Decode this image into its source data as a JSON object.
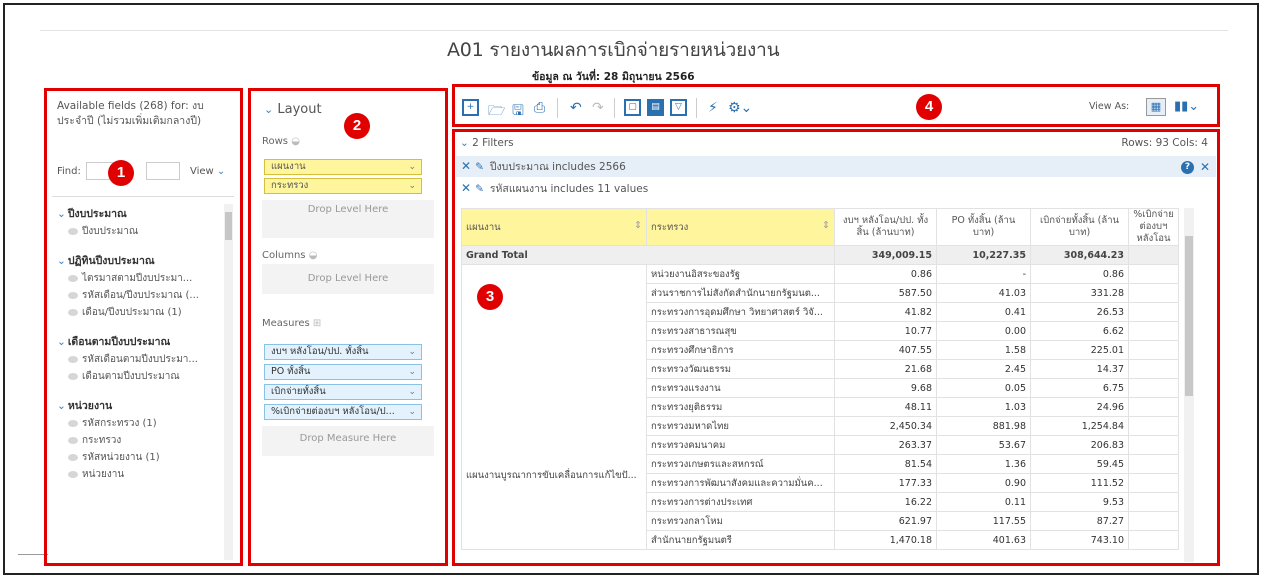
{
  "report": {
    "title": "A01 รายงานผลการเบิกจ่ายรายหน่วยงาน",
    "subtitle": "ข้อมูล ณ วันที่: 28 มิถุนายน 2566"
  },
  "badges": [
    "1",
    "2",
    "3",
    "4"
  ],
  "field_list": {
    "header": "Available fields (268) for: งบประจำปี (ไม่รวมเพิ่มเติมกลางปี)",
    "find_label": "Find:",
    "view_label": "View",
    "groups": [
      {
        "label": "ปีงบประมาณ",
        "items": [
          "ปีงบประมาณ"
        ]
      },
      {
        "label": "ปฏิทินปีงบประมาณ",
        "items": [
          "ไตรมาสตามปีงบประมา...",
          "รหัสเดือน/ปีงบประมาณ (...",
          "เดือน/ปีงบประมาณ (1)"
        ]
      },
      {
        "label": "เดือนตามปีงบประมาณ",
        "items": [
          "รหัสเดือนตามปีงบประมา...",
          "เดือนตามปีงบประมาณ"
        ]
      },
      {
        "label": "หน่วยงาน",
        "items": [
          "รหัสกระทรวง (1)",
          "กระทรวง",
          "รหัสหน่วยงาน (1)",
          "หน่วยงาน"
        ]
      }
    ]
  },
  "layout": {
    "title": "Layout",
    "rows_label": "Rows",
    "rows": [
      "แผนงาน",
      "กระทรวง"
    ],
    "drop_level": "Drop Level Here",
    "columns_label": "Columns",
    "columns_drop": "Drop Level Here",
    "measures_label": "Measures",
    "measures": [
      "งบฯ หลังโอน/ปป. ทั้งสิ้น",
      "PO ทั้งสิ้น",
      "เบิกจ่ายทั้งสิ้น",
      "%เบิกจ่ายต่องบฯ หลังโอน/ป..."
    ],
    "drop_measure": "Drop Measure Here"
  },
  "toolbar": {
    "view_as": "View As:",
    "icons": [
      "new-icon",
      "open-icon",
      "save-icon",
      "save-as-icon",
      "undo-icon",
      "redo-icon",
      "layout-icon",
      "table-icon",
      "filter-icon",
      "run-icon",
      "settings-icon",
      "grid-view-icon",
      "chart-view-icon"
    ]
  },
  "filters": {
    "summary": "2 Filters",
    "rows_cols": "Rows: 93  Cols: 4",
    "items": [
      "ปีงบประมาณ includes 2566",
      "รหัสแผนงาน includes 11 values"
    ]
  },
  "table": {
    "headers": [
      "แผนงาน",
      "กระทรวง",
      "งบฯ หลังโอน/ปป. ทั้งสิ้น (ล้านบาท)",
      "PO ทั้งสิ้น (ล้านบาท)",
      "เบิกจ่ายทั้งสิ้น (ล้านบาท)",
      "%เบิกจ่าย ต่องบฯ หลังโอน"
    ],
    "grand_total_label": "Grand Total",
    "grand_total": [
      "349,009.15",
      "10,227.35",
      "308,644.23"
    ],
    "plan_label": "แผนงานบูรณาการขับเคลื่อนการแก้ไขปั...",
    "rows": [
      {
        "ministry": "หน่วยงานอิสระของรัฐ",
        "budget": "0.86",
        "po": "-",
        "spent": "0.86"
      },
      {
        "ministry": "ส่วนราชการไม่สังกัดสำนักนายกรัฐมนต...",
        "budget": "587.50",
        "po": "41.03",
        "spent": "331.28"
      },
      {
        "ministry": "กระทรวงการอุดมศึกษา วิทยาศาสตร์ วิจั...",
        "budget": "41.82",
        "po": "0.41",
        "spent": "26.53"
      },
      {
        "ministry": "กระทรวงสาธารณสุข",
        "budget": "10.77",
        "po": "0.00",
        "spent": "6.62"
      },
      {
        "ministry": "กระทรวงศึกษาธิการ",
        "budget": "407.55",
        "po": "1.58",
        "spent": "225.01"
      },
      {
        "ministry": "กระทรวงวัฒนธรรม",
        "budget": "21.68",
        "po": "2.45",
        "spent": "14.37"
      },
      {
        "ministry": "กระทรวงแรงงาน",
        "budget": "9.68",
        "po": "0.05",
        "spent": "6.75"
      },
      {
        "ministry": "กระทรวงยุติธรรม",
        "budget": "48.11",
        "po": "1.03",
        "spent": "24.96"
      },
      {
        "ministry": "กระทรวงมหาดไทย",
        "budget": "2,450.34",
        "po": "881.98",
        "spent": "1,254.84"
      },
      {
        "ministry": "กระทรวงคมนาคม",
        "budget": "263.37",
        "po": "53.67",
        "spent": "206.83"
      },
      {
        "ministry": "กระทรวงเกษตรและสหกรณ์",
        "budget": "81.54",
        "po": "1.36",
        "spent": "59.45"
      },
      {
        "ministry": "กระทรวงการพัฒนาสังคมและความมั่นค...",
        "budget": "177.33",
        "po": "0.90",
        "spent": "111.52"
      },
      {
        "ministry": "กระทรวงการต่างประเทศ",
        "budget": "16.22",
        "po": "0.11",
        "spent": "9.53"
      },
      {
        "ministry": "กระทรวงกลาโหม",
        "budget": "621.97",
        "po": "117.55",
        "spent": "87.27"
      },
      {
        "ministry": "สำนักนายกรัฐมนตรี",
        "budget": "1,470.18",
        "po": "401.63",
        "spent": "743.10"
      }
    ]
  }
}
